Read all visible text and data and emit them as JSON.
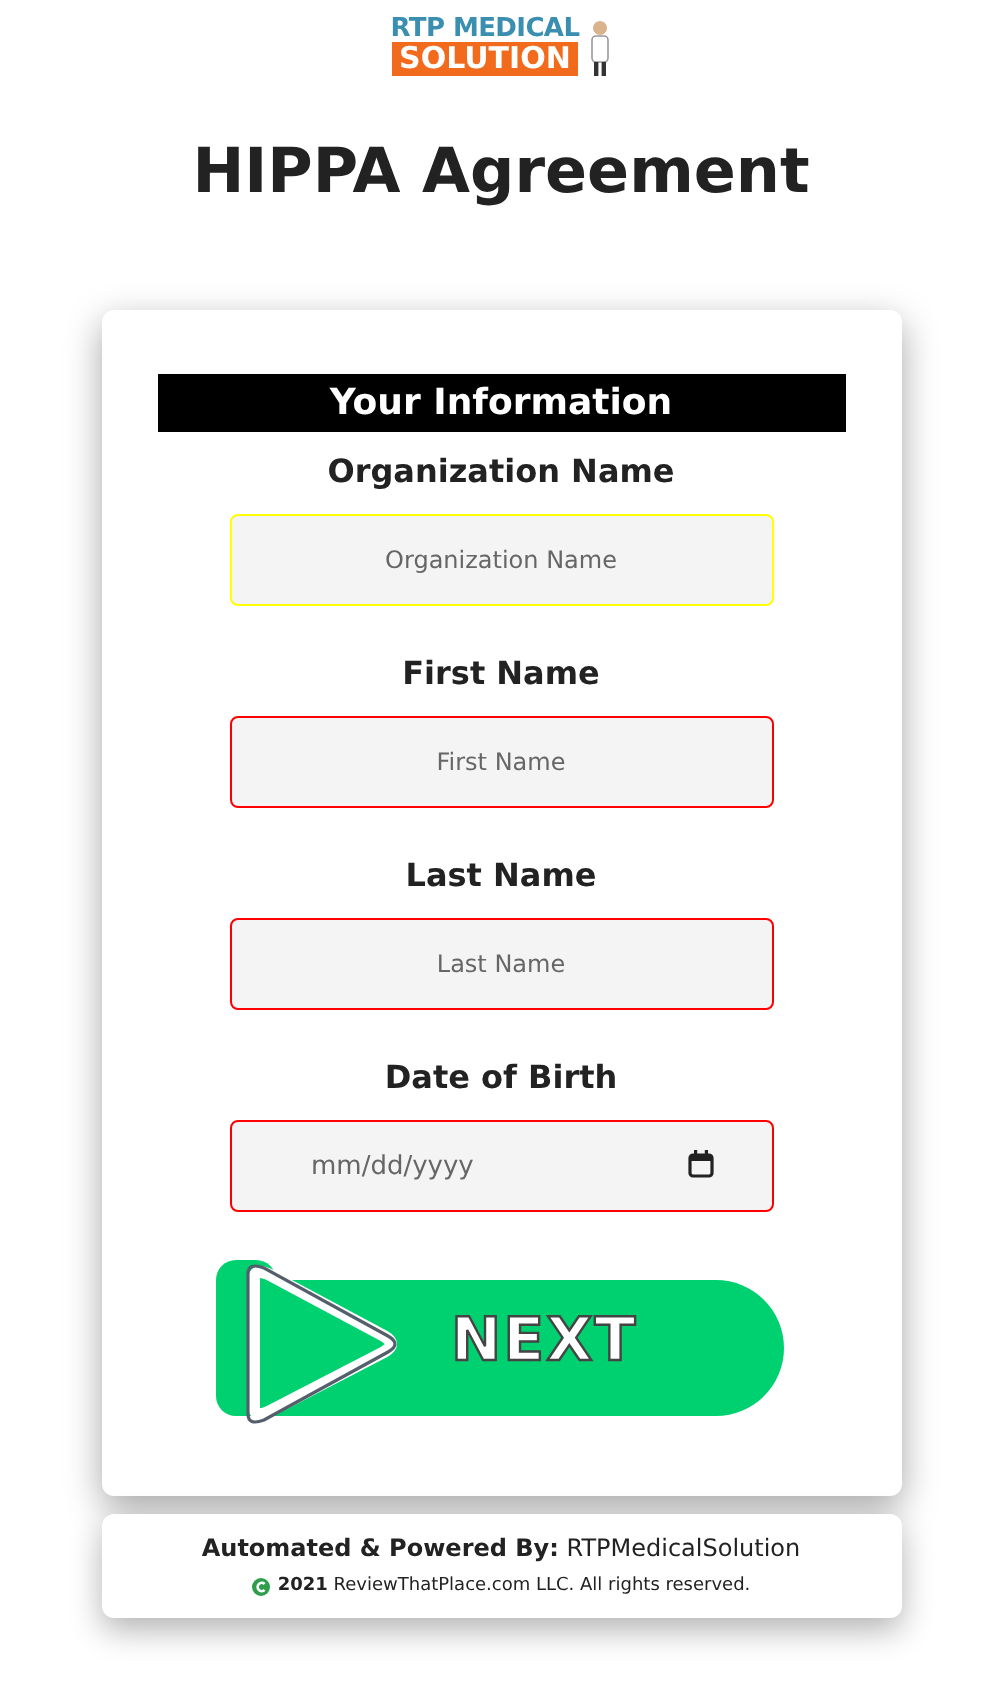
{
  "logo": {
    "top": "RTP MEDICAL",
    "bottom": "SOLUTION"
  },
  "title": "HIPPA Agreement",
  "section_title": "Your Information",
  "fields": [
    {
      "label": "Organization Name",
      "placeholder": "Organization Name",
      "kind": "text",
      "focused": true,
      "invalid": false
    },
    {
      "label": "First Name",
      "placeholder": "First Name",
      "kind": "text",
      "focused": false,
      "invalid": true
    },
    {
      "label": "Last Name",
      "placeholder": "Last Name",
      "kind": "text",
      "focused": false,
      "invalid": true
    },
    {
      "label": "Date of Birth",
      "placeholder": "mm/dd/yyyy",
      "kind": "date",
      "focused": false,
      "invalid": true
    }
  ],
  "next_button": "NEXT",
  "footer": {
    "powered": "**Automated & Powered By:** RTPMedicalSolution",
    "copyright": "**2021** ReviewThatPlace.com LLC. All rights reserved."
  }
}
